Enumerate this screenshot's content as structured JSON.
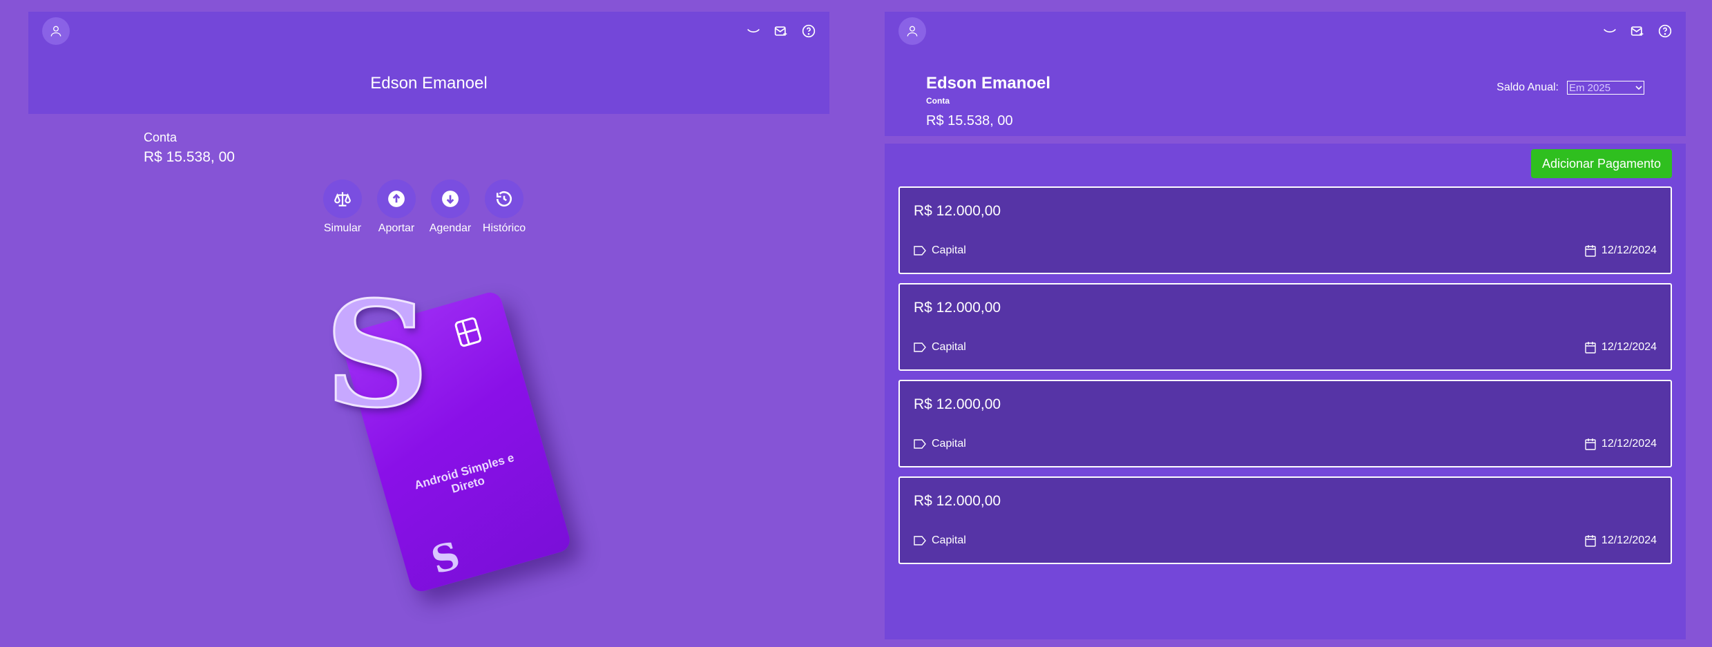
{
  "left": {
    "user_name": "Edson Emanoel",
    "balance_label": "Conta",
    "balance_value": "R$ 15.538, 00",
    "actions": [
      {
        "label": "Simular",
        "icon": "scale-icon"
      },
      {
        "label": "Aportar",
        "icon": "arrow-up-circle-icon"
      },
      {
        "label": "Agendar",
        "icon": "arrow-down-circle-icon"
      },
      {
        "label": "Histórico",
        "icon": "history-icon"
      }
    ],
    "card_text": "Android Simples e Direto",
    "logo_letter": "S"
  },
  "right": {
    "user_name": "Edson Emanoel",
    "balance_label": "Conta",
    "balance_value": "R$ 15.538, 00",
    "saldo_label": "Saldo Anual:",
    "saldo_selected": "Em 2025",
    "add_button": "Adicionar Pagamento",
    "payments": [
      {
        "amount": "R$ 12.000,00",
        "tag": "Capital",
        "date": "12/12/2024"
      },
      {
        "amount": "R$ 12.000,00",
        "tag": "Capital",
        "date": "12/12/2024"
      },
      {
        "amount": "R$ 12.000,00",
        "tag": "Capital",
        "date": "12/12/2024"
      },
      {
        "amount": "R$ 12.000,00",
        "tag": "Capital",
        "date": "12/12/2024"
      }
    ]
  },
  "colors": {
    "background": "#8654d6",
    "panel": "#7447d9",
    "payment_card": "#5634a6",
    "add_button": "#2fbf1f"
  }
}
